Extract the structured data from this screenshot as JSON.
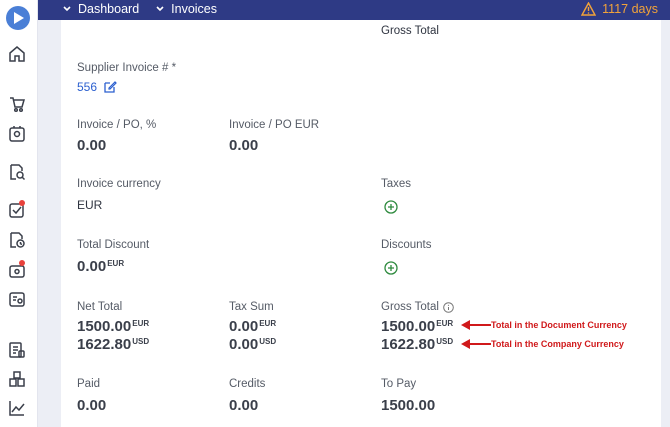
{
  "topbar": {
    "breadcrumbs": [
      "Dashboard",
      "Invoices"
    ],
    "warning_text": "1117 days",
    "warning_color": "#f2a33a",
    "bar_color": "#2e3a85"
  },
  "sidebar": {
    "icons": [
      "logo-icon",
      "home-icon",
      "cart-icon",
      "badge-icon",
      "search-doc-icon",
      "checklist-icon",
      "clock-doc-icon",
      "wallet-icon",
      "invoice-icon",
      "ledger-icon",
      "boxes-icon",
      "chart-icon"
    ]
  },
  "form": {
    "top_label": "Gross Total",
    "supplier_invoice": {
      "label": "Supplier Invoice # *",
      "value": "556"
    },
    "invoice_po_pct": {
      "label": "Invoice / PO, %",
      "value": "0.00"
    },
    "invoice_po_eur": {
      "label": "Invoice / PO EUR",
      "value": "0.00"
    },
    "invoice_currency": {
      "label": "Invoice currency",
      "value": "EUR"
    },
    "taxes": {
      "label": "Taxes"
    },
    "total_discount": {
      "label": "Total Discount",
      "value": "0.00",
      "currency": "EUR"
    },
    "discounts": {
      "label": "Discounts"
    },
    "net_total": {
      "label": "Net Total",
      "value1": "1500.00",
      "cur1": "EUR",
      "value2": "1622.80",
      "cur2": "USD"
    },
    "tax_sum": {
      "label": "Tax Sum",
      "value1": "0.00",
      "cur1": "EUR",
      "value2": "0.00",
      "cur2": "USD"
    },
    "gross_total": {
      "label": "Gross Total",
      "value1": "1500.00",
      "cur1": "EUR",
      "value2": "1622.80",
      "cur2": "USD"
    },
    "paid": {
      "label": "Paid",
      "value": "0.00"
    },
    "credits": {
      "label": "Credits",
      "value": "0.00"
    },
    "to_pay": {
      "label": "To Pay",
      "value": "1500.00"
    }
  },
  "annotations": {
    "doc_currency": "Total in the Document Currency",
    "company_currency": "Total in the Company Currency",
    "color": "#d0191b"
  }
}
